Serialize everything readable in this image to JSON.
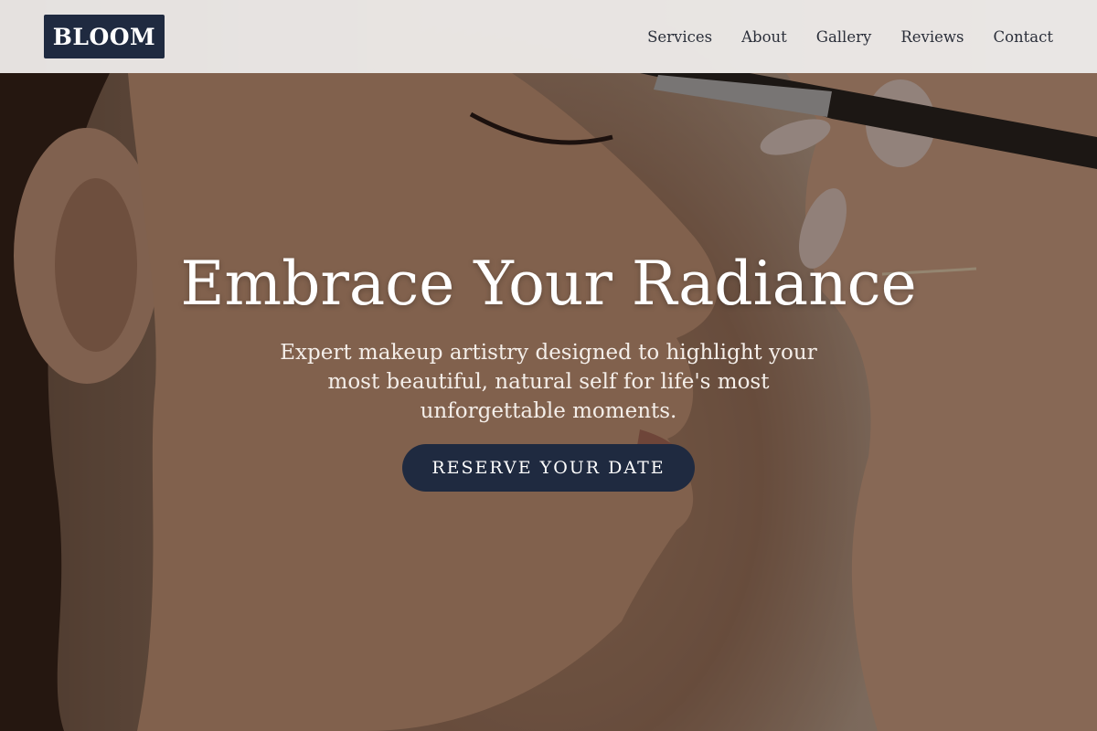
{
  "brand": {
    "logo_text": "BLOOM",
    "primary_color": "#1f2a40"
  },
  "nav": {
    "items": [
      {
        "label": "Services"
      },
      {
        "label": "About"
      },
      {
        "label": "Gallery"
      },
      {
        "label": "Reviews"
      },
      {
        "label": "Contact"
      }
    ]
  },
  "hero": {
    "title": "Embrace Your Radiance",
    "subtitle": "Expert makeup artistry designed to highlight your most beautiful, natural self for life's most unforgettable moments.",
    "cta_label": "RESERVE YOUR DATE",
    "image_subject": "woman-profile-makeup-brush-photo"
  }
}
